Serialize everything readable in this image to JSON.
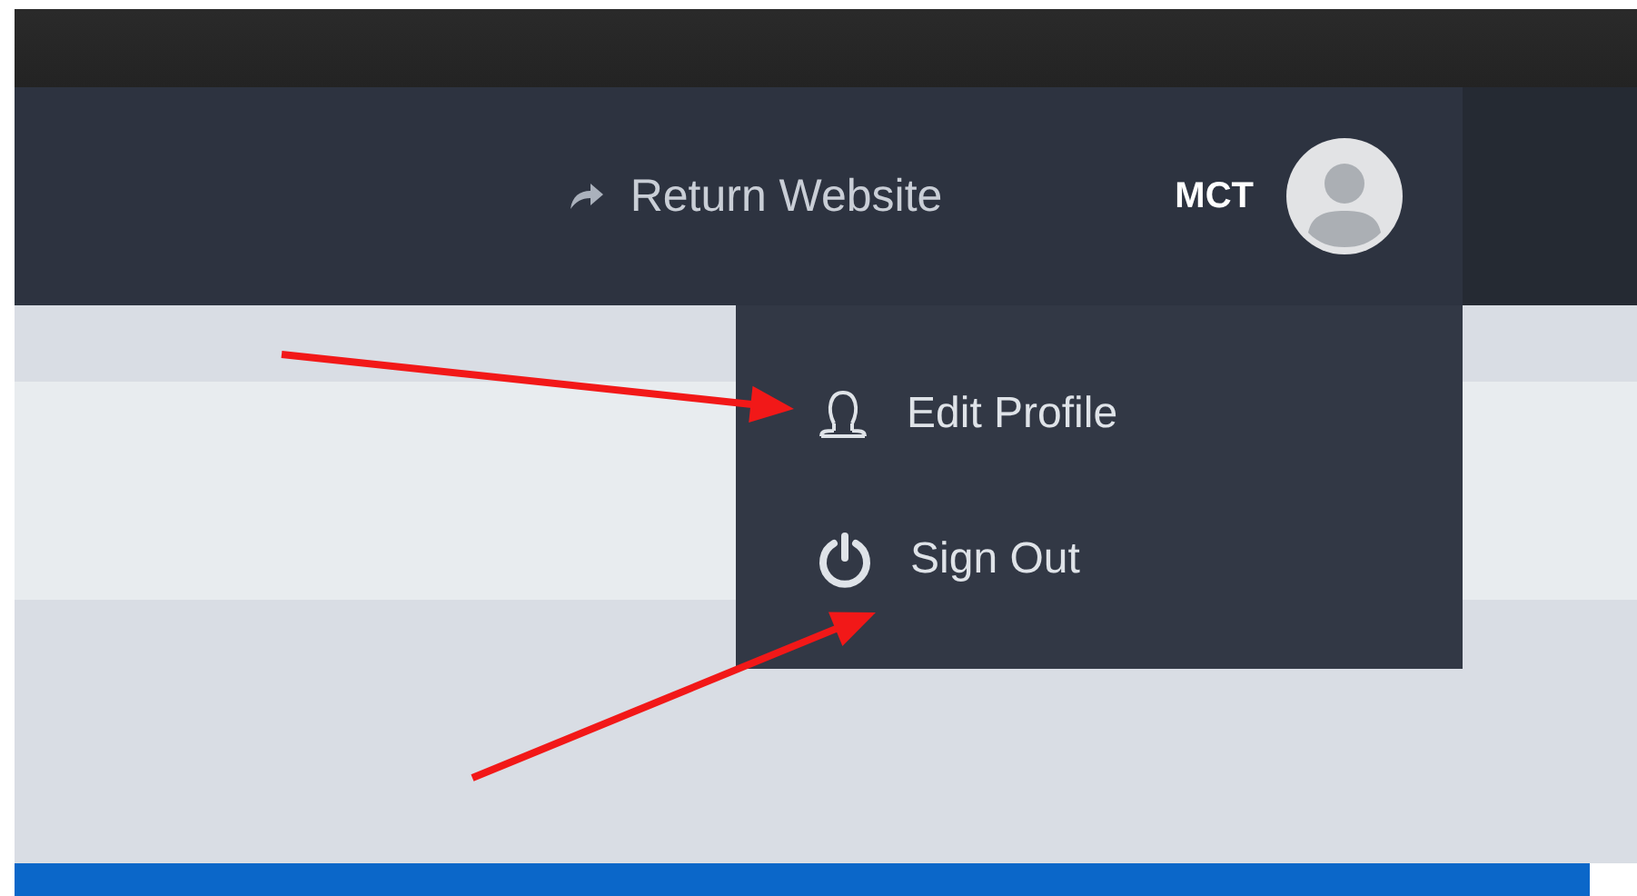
{
  "navbar": {
    "return_link": "Return Website",
    "user": {
      "name": "MCT"
    }
  },
  "user_menu": {
    "items": [
      {
        "kind": "profile",
        "label": "Edit Profile"
      },
      {
        "kind": "signout",
        "label": "Sign Out"
      }
    ]
  }
}
